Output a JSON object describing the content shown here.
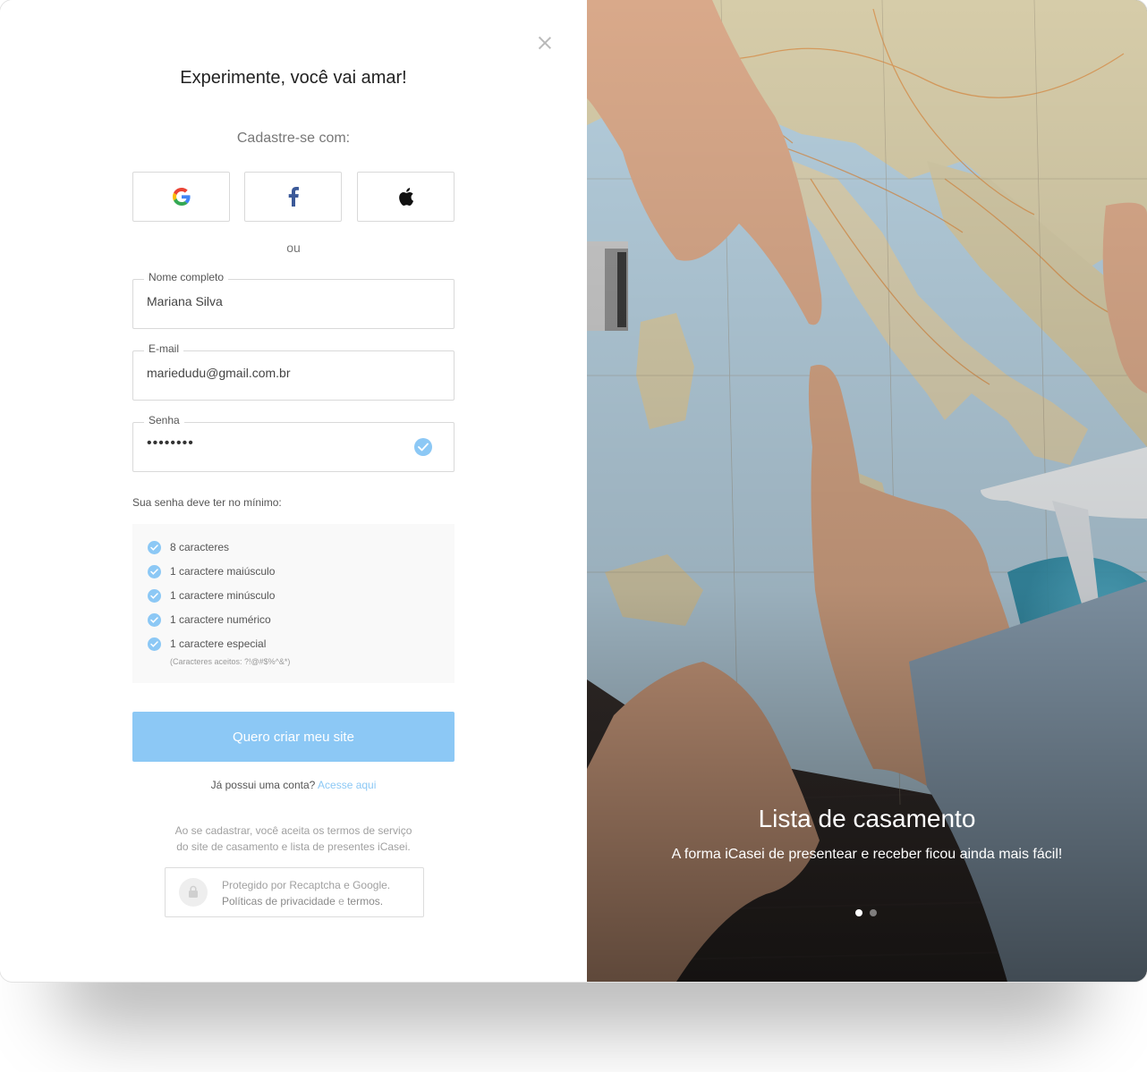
{
  "signup": {
    "title": "Experimente, você vai amar!",
    "subtitle": "Cadastre-se com:",
    "social": [
      {
        "name": "google-icon"
      },
      {
        "name": "facebook-icon"
      },
      {
        "name": "apple-icon"
      }
    ],
    "or": "ou",
    "fields": {
      "name": {
        "label": "Nome completo",
        "value": "Mariana Silva"
      },
      "email": {
        "label": "E-mail",
        "value": "mariedudu@gmail.com.br"
      },
      "password": {
        "label": "Senha",
        "value": "••••••••",
        "valid": true
      }
    },
    "requirements_title": "Sua senha deve ter no mínimo:",
    "requirements": [
      {
        "label": "8 caracteres",
        "met": true
      },
      {
        "label": "1 caractere maiúsculo",
        "met": true
      },
      {
        "label": "1 caractere minúsculo",
        "met": true
      },
      {
        "label": "1 caractere numérico",
        "met": true
      },
      {
        "label": "1 caractere especial",
        "met": true
      }
    ],
    "requirements_note": "(Caracteres aceitos: ?!@#$%^&*)",
    "submit_label": "Quero criar meu site",
    "login_prompt": "Já possui uma conta?",
    "login_link": "Acesse aqui",
    "terms_line1": "Ao se cadastrar, você aceita os termos de serviço",
    "terms_line2": "do site de casamento e lista de presentes iCasei.",
    "recaptcha": {
      "line1": "Protegido por Recaptcha e Google.",
      "privacy": "Políticas de privacidade",
      "and": " e ",
      "terms": "termos."
    }
  },
  "hero": {
    "title": "Lista de casamento",
    "subtitle": "A forma iCasei de presentear e receber ficou ainda mais fácil!",
    "slides_total": 2,
    "active_slide": 1
  },
  "colors": {
    "accent": "#8cc8f5",
    "check": "#8cc8f5",
    "map_sea": "#a9c6d8",
    "map_land": "#d9cfb2",
    "table_wood": "#3a3230"
  }
}
